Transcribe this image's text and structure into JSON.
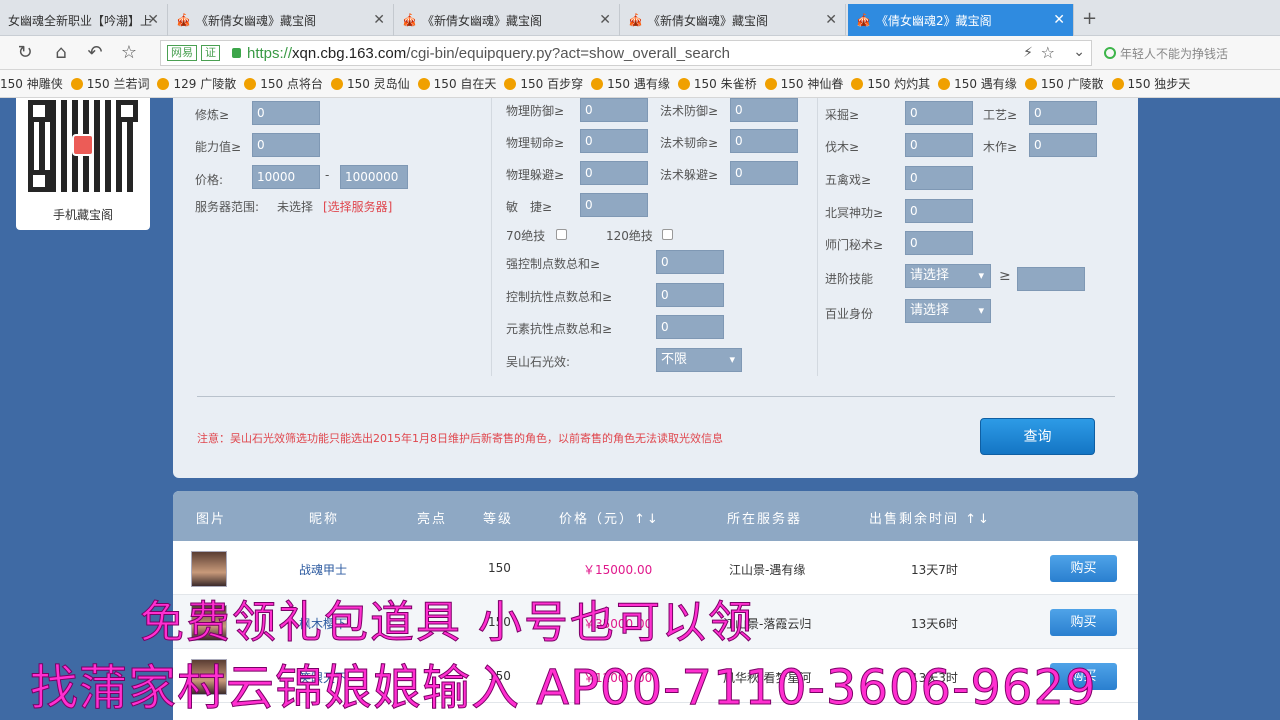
{
  "tabs": [
    {
      "title": "女幽魂全新职业【吟潮】上",
      "active": false
    },
    {
      "title": "《新倩女幽魂》藏宝阁",
      "active": false
    },
    {
      "title": "《新倩女幽魂》藏宝阁",
      "active": false
    },
    {
      "title": "《新倩女幽魂》藏宝阁",
      "active": false
    },
    {
      "title": "《倩女幽魂2》藏宝阁",
      "active": true
    }
  ],
  "address": {
    "badge1": "网易",
    "badge2": "证",
    "url_scheme": "https://",
    "url_host": "xqn.cbg.163.com",
    "url_path": "/cgi-bin/equipquery.py?act=show_overall_search",
    "search_placeholder": "年轻人不能为挣钱活"
  },
  "bookmarks": [
    "150 神雕侠",
    "150 兰若词",
    "129 广陵散",
    "150 点将台",
    "150 灵岛仙",
    "150 自在天",
    "150 百步穿",
    "150 遇有缘",
    "150 朱雀桥",
    "150 神仙眷",
    "150 灼灼其",
    "150 遇有缘",
    "150 广陵散",
    "150 独步天"
  ],
  "qr": {
    "label": "手机藏宝阁"
  },
  "filters": {
    "col1": {
      "xiulian": "修炼≥",
      "xiulian_val": "0",
      "nengli": "能力值≥",
      "nengli_val": "0",
      "price": "价格:",
      "price_min": "10000",
      "price_dash": "-",
      "price_max": "1000000",
      "server": "服务器范围:",
      "server_val": "未选择",
      "server_link": "[选择服务器]"
    },
    "col2": {
      "wfy": "物理防御≥",
      "wfy_val": "0",
      "fsfy": "法术防御≥",
      "fsfy_val": "0",
      "wrm": "物理韧命≥",
      "wrm_val": "0",
      "fsrm": "法术韧命≥",
      "fsrm_val": "0",
      "wdb": "物理躲避≥",
      "wdb_val": "0",
      "fsdb": "法术躲避≥",
      "fsdb_val": "0",
      "mj": "敏　捷≥",
      "mj_val": "0",
      "jj70": "70绝技",
      "jj120": "120绝技",
      "qkz": "强控制点数总和≥",
      "qkz_val": "0",
      "kzkx": "控制抗性点数总和≥",
      "kzkx_val": "0",
      "ysk": "元素抗性点数总和≥",
      "ysk_val": "0",
      "wss": "吴山石光效:",
      "wss_val": "不限"
    },
    "col3": {
      "caijue": "采掘≥",
      "caijue_val": "0",
      "gongyi": "工艺≥",
      "gongyi_val": "0",
      "famu": "伐木≥",
      "famu_val": "0",
      "muzuo": "木作≥",
      "muzuo_val": "0",
      "wqx": "五禽戏≥",
      "wqx_val": "0",
      "bmsg": "北冥神功≥",
      "bmsg_val": "0",
      "smmj": "师门秘术≥",
      "smmj_val": "0",
      "jjjn": "进阶技能",
      "jjjn_val": "请选择",
      "ge": "≥",
      "byss": "百业身份",
      "byss_val": "请选择"
    },
    "note": "注意：吴山石光效筛选功能只能选出2015年1月8日维护后新寄售的角色，以前寄售的角色无法读取光效信息",
    "query_label": "查询"
  },
  "table": {
    "headers": {
      "pic": "图片",
      "nick": "昵称",
      "spot": "亮点",
      "level": "等级",
      "price": "价格（元）↑↓",
      "server": "所在服务器",
      "time": "出售剩余时间 ↑↓"
    },
    "buy_label": "购买",
    "rows": [
      {
        "nick": "战魂甲士",
        "level": "150",
        "price": "￥15000.00",
        "server": "江山景-遇有缘",
        "time": "13天7时"
      },
      {
        "nick": "枫木樱下",
        "level": "150",
        "price": "￥35000.00",
        "server": "江山景-落霞云归",
        "time": "13天6时"
      },
      {
        "nick": "笑眼天下",
        "level": "150",
        "price": "￥12000.00",
        "server": "风华秋-看梦星河",
        "time": "13天3时"
      }
    ]
  },
  "overlay": {
    "line1": "免费领礼包道具 小号也可以领",
    "line2": "找蒲家村云锦娘娘输入 AP00-7110-3606-9629"
  }
}
